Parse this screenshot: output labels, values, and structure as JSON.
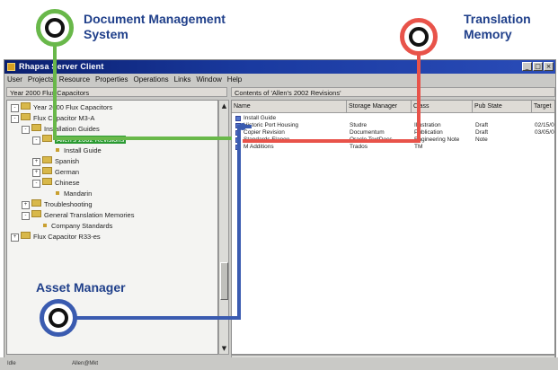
{
  "annotations": {
    "dms_title_line1": "Document Management",
    "dms_title_line2": "System",
    "tm_title_line1": "Translation",
    "tm_title_line2": "Memory",
    "asset_title": "Asset Manager",
    "colors": {
      "dms": "#69b84a",
      "tm": "#e8534a",
      "asset": "#3a5bb0",
      "text": "#1f3f8a"
    }
  },
  "window": {
    "title": "Rhapsa Server Client",
    "menu": [
      "User",
      "Projects",
      "Resource",
      "Properties",
      "Operations",
      "Links",
      "Window",
      "Help"
    ],
    "left_header": "Year 2000 Flux Capacitors",
    "right_header": "Contents of 'Allen's 2002 Revisions'"
  },
  "tree": {
    "items": [
      {
        "label": "Year 2000 Flux Capacitors",
        "toggle": "-",
        "icon": "folder"
      },
      {
        "label": "Flux Capacitor M3-A",
        "toggle": "-",
        "icon": "folder"
      },
      {
        "label": "Installation Guides",
        "toggle": "-",
        "icon": "folder"
      },
      {
        "label": "Allen's 2002 Revisions",
        "toggle": "-",
        "icon": "folder",
        "selected": true
      },
      {
        "label": "Install Guide",
        "toggle": "",
        "icon": "bullet"
      },
      {
        "label": "Spanish",
        "toggle": "+",
        "icon": "folder"
      },
      {
        "label": "German",
        "toggle": "+",
        "icon": "folder"
      },
      {
        "label": "Chinese",
        "toggle": "-",
        "icon": "folder"
      },
      {
        "label": "Mandarin",
        "toggle": "",
        "icon": "bullet"
      },
      {
        "label": "Troubleshooting",
        "toggle": "+",
        "icon": "folder"
      },
      {
        "label": "General Translation Memories",
        "toggle": "-",
        "icon": "folder"
      },
      {
        "label": "Company Standards",
        "toggle": "",
        "icon": "bullet"
      },
      {
        "label": "Flux Capacitor R33-es",
        "toggle": "+",
        "icon": "folder"
      }
    ]
  },
  "list": {
    "columns": [
      "Name",
      "Storage Manager",
      "Class",
      "Pub State",
      "Target"
    ],
    "rows": [
      {
        "name": "Install Guide",
        "storage": "",
        "class": "",
        "pub": "",
        "target": ""
      },
      {
        "name": "Historic Port Housing",
        "storage": "Studre",
        "class": "Illustration",
        "pub": "Draft",
        "target": "02/15/0"
      },
      {
        "name": "Copier Revision",
        "storage": "Documentum",
        "class": "Publication",
        "pub": "Draft",
        "target": "03/05/0"
      },
      {
        "name": "Standards Flange",
        "storage": "Oracle TextDocs",
        "class": "Engineering Note",
        "pub": "Note",
        "target": ""
      },
      {
        "name": "M Additions",
        "storage": "Trados",
        "class": "TM",
        "pub": "",
        "target": ""
      }
    ]
  },
  "status": {
    "left": "Idle",
    "middle": "Allen@Mkt"
  }
}
